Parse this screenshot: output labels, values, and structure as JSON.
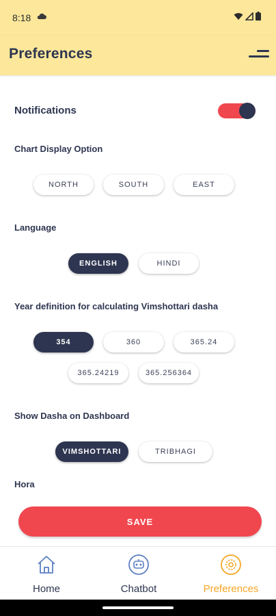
{
  "status_bar": {
    "time": "8:18"
  },
  "app_bar": {
    "title": "Preferences"
  },
  "notifications": {
    "label": "Notifications",
    "enabled": true
  },
  "chart_display": {
    "label": "Chart Display Option",
    "options": [
      "NORTH",
      "SOUTH",
      "EAST"
    ],
    "selected": ""
  },
  "language": {
    "label": "Language",
    "options": [
      "ENGLISH",
      "HINDI"
    ],
    "selected": "ENGLISH"
  },
  "year_definition": {
    "label": "Year definition for calculating Vimshottari dasha",
    "options": [
      "354",
      "360",
      "365.24",
      "365.24219",
      "365.256364"
    ],
    "selected": "354"
  },
  "show_dasha": {
    "label": "Show Dasha on Dashboard",
    "options": [
      "VIMSHOTTARI",
      "TRIBHAGI"
    ],
    "selected": "VIMSHOTTARI"
  },
  "hora": {
    "label": "Hora"
  },
  "save_button": {
    "label": "SAVE"
  },
  "bottom_nav": {
    "items": [
      {
        "label": "Home",
        "icon": "home-icon",
        "active": false
      },
      {
        "label": "Chatbot",
        "icon": "chatbot-icon",
        "active": false
      },
      {
        "label": "Preferences",
        "icon": "settings-icon",
        "active": true
      }
    ]
  },
  "colors": {
    "header_bg": "#fce79a",
    "accent_red": "#f0474f",
    "navy": "#2d3550",
    "active_nav": "#f5a623",
    "nav_icon_blue": "#5c7fc2"
  }
}
